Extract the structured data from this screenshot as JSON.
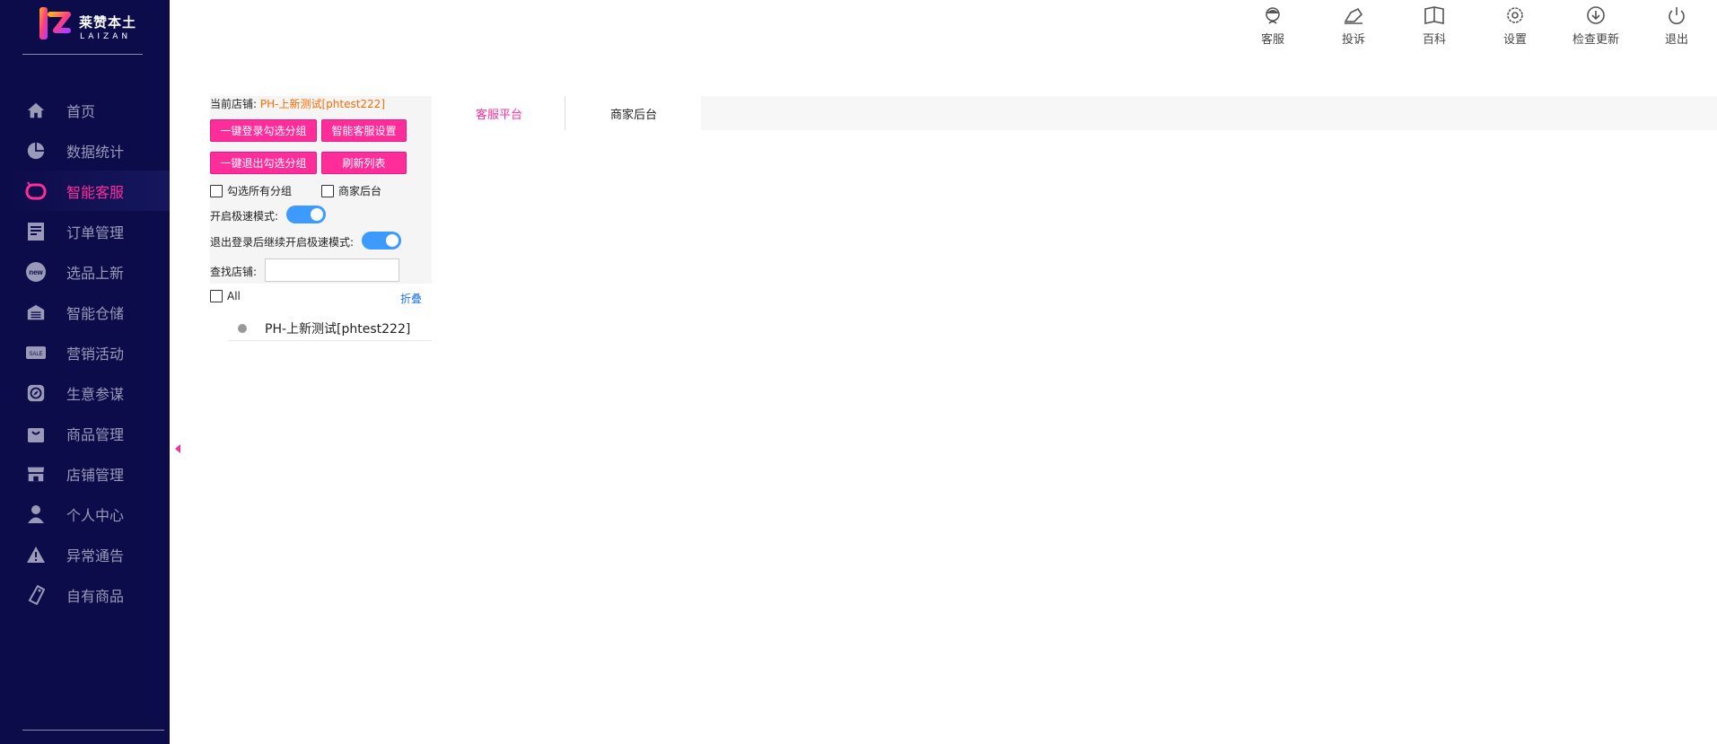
{
  "brand": {
    "name_cn": "莱赞本土",
    "name_en": "LAIZAN"
  },
  "sidebar": {
    "items": [
      {
        "label": "首页",
        "icon": "home-icon",
        "active": false
      },
      {
        "label": "数据统计",
        "icon": "pie-chart-icon",
        "active": false
      },
      {
        "label": "智能客服",
        "icon": "customer-service-icon",
        "active": true
      },
      {
        "label": "订单管理",
        "icon": "order-icon",
        "active": false
      },
      {
        "label": "选品上新",
        "icon": "new-badge-icon",
        "active": false
      },
      {
        "label": "智能仓储",
        "icon": "warehouse-icon",
        "active": false
      },
      {
        "label": "营销活动",
        "icon": "sale-tag-icon",
        "active": false
      },
      {
        "label": "生意参谋",
        "icon": "compass-icon",
        "active": false
      },
      {
        "label": "商品管理",
        "icon": "shopping-bag-icon",
        "active": false
      },
      {
        "label": "店铺管理",
        "icon": "store-icon",
        "active": false
      },
      {
        "label": "个人中心",
        "icon": "user-icon",
        "active": false
      },
      {
        "label": "异常通告",
        "icon": "warning-icon",
        "active": false
      },
      {
        "label": "自有商品",
        "icon": "price-tag-icon",
        "active": false
      }
    ]
  },
  "topbar": {
    "items": [
      {
        "label": "客服",
        "icon": "agent-icon"
      },
      {
        "label": "投诉",
        "icon": "complaint-icon"
      },
      {
        "label": "百科",
        "icon": "book-icon"
      },
      {
        "label": "设置",
        "icon": "gear-icon"
      },
      {
        "label": "检查更新",
        "icon": "download-icon"
      },
      {
        "label": "退出",
        "icon": "power-icon"
      }
    ]
  },
  "panel": {
    "current_store_label": "当前店铺:",
    "current_store_value": "PH-上新测试[phtest222]",
    "btn_login_groups": "一键登录勾选分组",
    "btn_cs_settings": "智能客服设置",
    "btn_logout_groups": "一键退出勾选分组",
    "btn_refresh": "刷新列表",
    "chk_all_groups": "勾选所有分组",
    "chk_merchant_backend": "商家后台",
    "fast_mode_label": "开启极速模式:",
    "fast_mode_on": true,
    "fast_after_logout_label": "退出登录后继续开启极速模式:",
    "fast_after_logout_on": true,
    "search_label": "查找店铺:",
    "search_value": ""
  },
  "tree": {
    "all_label": "All",
    "fold_label": "折叠",
    "items": [
      {
        "label": "PH-上新测试[phtest222]"
      }
    ]
  },
  "tabs": [
    {
      "label": "客服平台",
      "active": true
    },
    {
      "label": "商家后台",
      "active": false
    }
  ],
  "colors": {
    "sidebar_bg": "#0c0c4a",
    "accent": "#ff2d9a",
    "toggle": "#3d9bff",
    "store_value": "#ff6a00",
    "link": "#1e6fff"
  }
}
